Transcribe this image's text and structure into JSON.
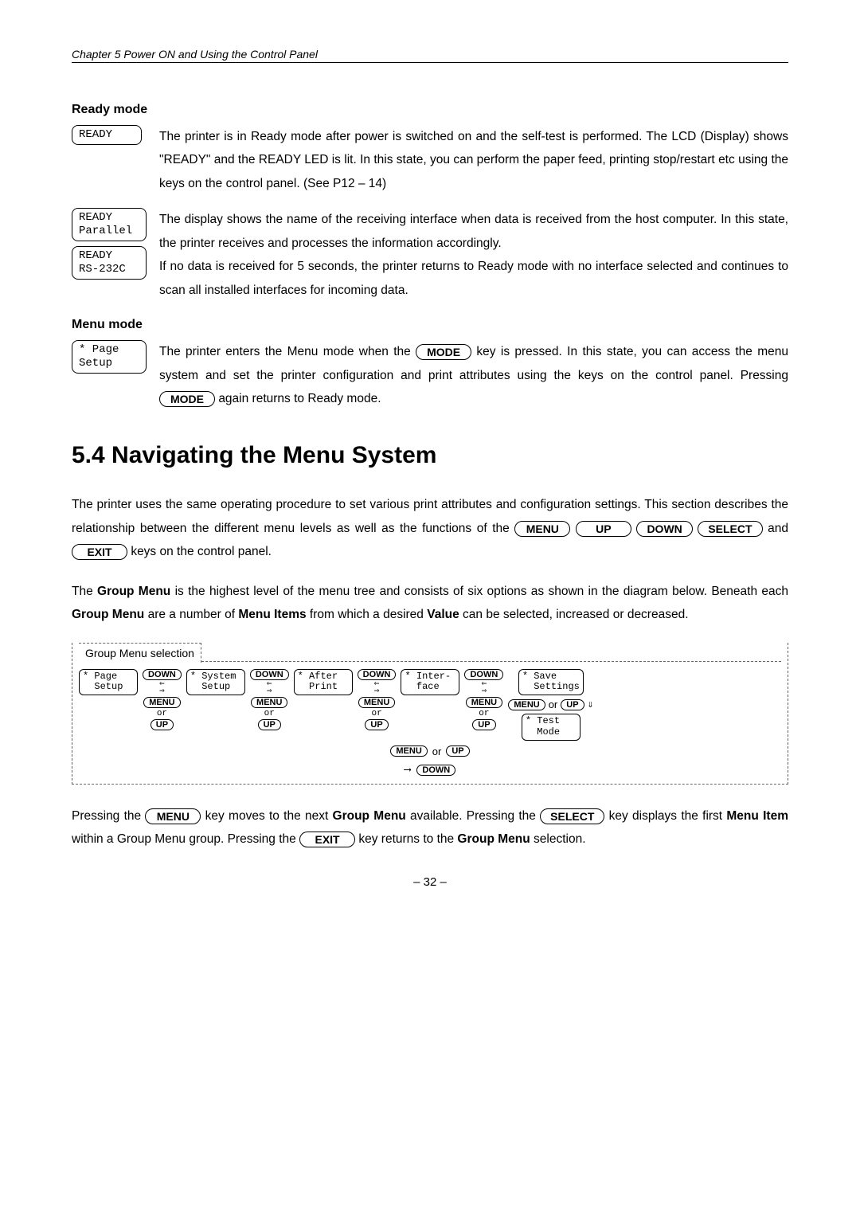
{
  "chapter_header": "Chapter 5   Power ON and Using the Control Panel",
  "ready_mode": {
    "title": "Ready mode",
    "lcd1": "READY",
    "para1": "The printer is in Ready mode after power is switched on and the self-test is performed. The LCD (Display) shows \"READY\" and the READY LED is lit. In this state, you can perform the paper feed, printing stop/restart etc using the keys on the control panel. (See P12 – 14)",
    "lcd2_line1": "READY",
    "lcd2_line2": "Parallel",
    "lcd3_line1": "READY",
    "lcd3_line2": "RS-232C",
    "para2": "The display shows the name of the receiving interface when data is received from the host computer. In this state, the printer receives and processes the information accordingly.",
    "para3": "If no data is received for 5 seconds, the printer returns to Ready mode with no interface selected and continues to scan all installed interfaces for incoming data."
  },
  "menu_mode": {
    "title": "Menu mode",
    "lcd_line1": "* Page",
    "lcd_line2": "  Setup",
    "text_pre": "The printer enters the Menu mode when the ",
    "key1": "MODE",
    "text_mid": " key is pressed. In this state, you can access the menu system and set the printer configuration and print attributes using the keys on the control panel. Pressing ",
    "key2": "MODE",
    "text_post": " again returns to Ready mode."
  },
  "section_5_4": {
    "heading": "5.4   Navigating the Menu System",
    "p1_pre": "The printer uses the same operating procedure to set various print attributes and configuration settings. This section describes the relationship between the different menu levels as well as the functions of the ",
    "k_menu": "MENU",
    "k_up": "UP",
    "k_down": "DOWN",
    "k_select": "SELECT",
    "p1_and": " and ",
    "k_exit": "EXIT",
    "p1_post": " keys on the control panel.",
    "p2_a": "The ",
    "p2_b": "Group Menu",
    "p2_c": " is the highest level of the menu tree and consists of six options as shown in the diagram below. Beneath each ",
    "p2_d": "Group Menu",
    "p2_e": " are a number of ",
    "p2_f": "Menu Items",
    "p2_g": " from which a desired ",
    "p2_h": "Value",
    "p2_i": " can be selected, increased or decreased."
  },
  "diagram": {
    "title": "Group Menu selection",
    "node1": "* Page\n  Setup",
    "node2": "* System\n  Setup",
    "node3": "* After\n  Print",
    "node4": "* Inter-\n  face",
    "node5": "* Save\n  Settings",
    "node6": "* Test\n  Mode",
    "down": "DOWN",
    "menu": "MENU",
    "up": "UP",
    "or": "or"
  },
  "p3": {
    "a": "Pressing the ",
    "k_menu": "MENU",
    "b": " key moves to the next ",
    "c": "Group Menu",
    "d": " available. Pressing the ",
    "k_select": "SELECT",
    "e": " key displays the first ",
    "f": "Menu Item",
    "g": " within a Group Menu group. Pressing the ",
    "k_exit": "EXIT",
    "h": " key returns to the ",
    "i": "Group Menu",
    "j": " selection."
  },
  "page_number": "– 32 –"
}
